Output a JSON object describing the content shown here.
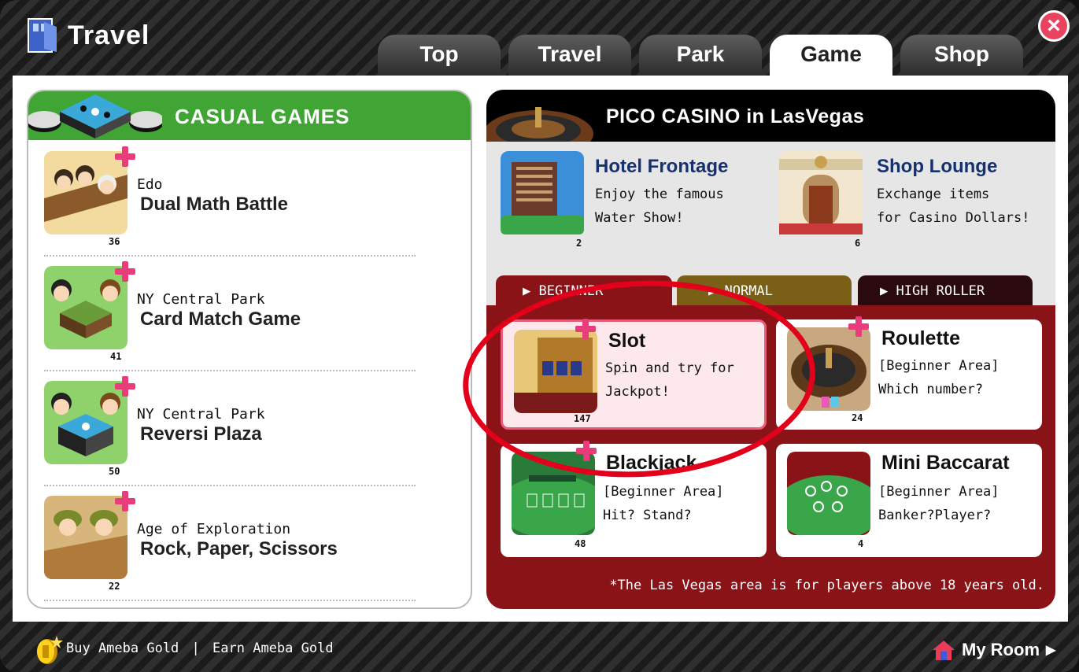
{
  "window": {
    "title": "Travel",
    "close_label": "×"
  },
  "tabs": [
    {
      "label": "Top",
      "active": false
    },
    {
      "label": "Travel",
      "active": false
    },
    {
      "label": "Park",
      "active": false
    },
    {
      "label": "Game",
      "active": true
    },
    {
      "label": "Shop",
      "active": false
    }
  ],
  "casual": {
    "header": "CASUAL GAMES",
    "items": [
      {
        "location": "Edo",
        "name": "Dual Math Battle",
        "count": "36"
      },
      {
        "location": "NY Central Park",
        "name": "Card Match Game",
        "count": "41"
      },
      {
        "location": "NY Central Park",
        "name": "Reversi Plaza",
        "count": "50"
      },
      {
        "location": "Age of Exploration",
        "name": "Rock, Paper, Scissors",
        "count": "22"
      }
    ]
  },
  "casino": {
    "header": "PICO CASINO in LasVegas",
    "features": [
      {
        "title": "Hotel Frontage",
        "line1": "Enjoy the famous",
        "line2": "Water Show!",
        "count": "2"
      },
      {
        "title": "Shop Lounge",
        "line1": "Exchange items",
        "line2": "for Casino Dollars!",
        "count": "6"
      }
    ],
    "levels": [
      "BEGINNER",
      "NORMAL",
      "HIGH ROLLER"
    ],
    "games": [
      {
        "title": "Slot",
        "line1": "Spin and try for",
        "line2": "Jackpot!",
        "count": "147"
      },
      {
        "title": "Roulette",
        "line1": "[Beginner Area]",
        "line2": "Which number?",
        "count": "24"
      },
      {
        "title": "Blackjack",
        "line1": "[Beginner Area]",
        "line2": "Hit? Stand?",
        "count": "48"
      },
      {
        "title": "Mini Baccarat",
        "line1": "[Beginner Area]",
        "line2": "Banker?Player?",
        "count": "4"
      }
    ],
    "notice": "*The Las Vegas area is for players above 18 years old."
  },
  "footer": {
    "buy": "Buy Ameba Gold",
    "divider": "|",
    "earn": "Earn Ameba Gold",
    "my_room": "My Room"
  },
  "colors": {
    "green": "#40a534",
    "casino_red": "#8a1318",
    "pink": "#e83d7a",
    "ring_red": "#e2001a"
  }
}
